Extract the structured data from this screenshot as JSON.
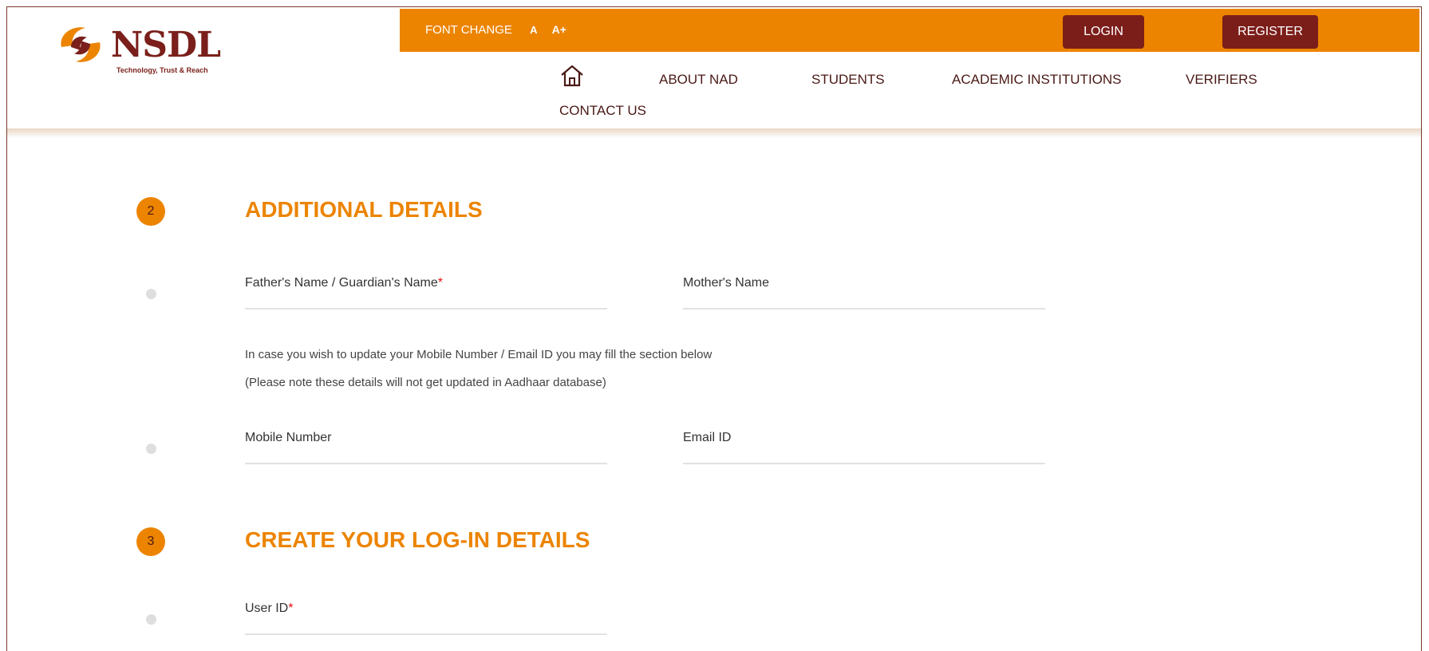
{
  "header": {
    "logo_text": "NSDL",
    "logo_tagline": "Technology, Trust & Reach",
    "font_change_label": "FONT CHANGE",
    "font_small": "A",
    "font_large": "A+",
    "login_label": "LOGIN",
    "register_label": "REGISTER",
    "brand_color": "#ec8400",
    "accent_color": "#7b1e1a"
  },
  "nav": {
    "home_icon": "home-icon",
    "items": [
      "ABOUT NAD",
      "STUDENTS",
      "ACADEMIC INSTITUTIONS",
      "VERIFIERS",
      "CONTACT US"
    ]
  },
  "section2": {
    "number": "2",
    "title": "ADDITIONAL DETAILS",
    "father_label": "Father's Name / Guardian's Name",
    "required_mark": "*",
    "mother_label": "Mother's Name",
    "note_line1": "In case you wish to update your Mobile Number / Email ID you may fill the section below",
    "note_line2": "(Please note these details will not get updated in Aadhaar database)",
    "mobile_label": "Mobile Number",
    "email_label": "Email ID"
  },
  "section3": {
    "number": "3",
    "title": "CREATE YOUR LOG-IN DETAILS",
    "userid_label": "User ID",
    "required_mark": "*"
  }
}
